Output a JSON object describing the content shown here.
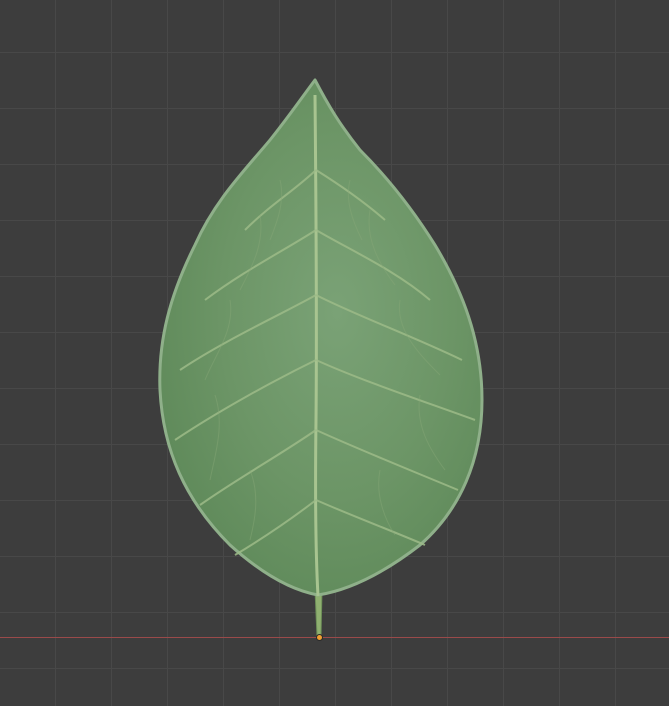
{
  "viewport": {
    "background_color": "#3d3d3d",
    "grid_color": "#484848",
    "x_axis_color": "#9a4a4a"
  },
  "object": {
    "type": "leaf-mesh",
    "base_color": "#6f9868",
    "vein_color": "#a8c490",
    "edge_color": "#8fb08a",
    "origin_color": "#f0a030"
  }
}
